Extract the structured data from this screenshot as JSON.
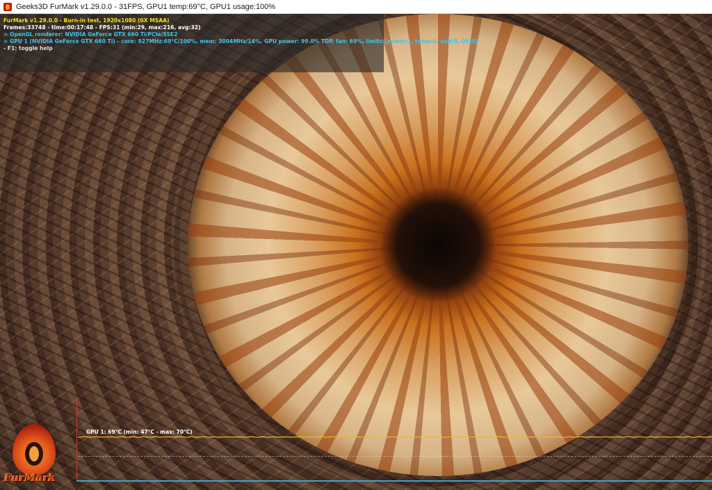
{
  "window": {
    "title": "Geeks3D FurMark v1.29.0.0 - 31FPS, GPU1 temp:69°C, GPU1 usage:100%",
    "icon": "furmark-app-icon"
  },
  "overlay": {
    "line1": "FurMark v1.29.0.0 - Burn-in test, 1920x1080 (0X MSAA)",
    "line2": "Frames:33748 - time:00:17:48 - FPS:31 (min:29, max:216, avg:32)",
    "line3": "> OpenGL renderer: NVIDIA GeForce GTX 660 Ti/PCIe/SSE2",
    "line4": "> GPU 1 (NVIDIA GeForce GTX 660 Ti) - core: 927MHz:69°C/100%, mem: 3004MHz/14%, GPU power: 99.0% TDP, fan: 69%, limits:[power:1, temp:0, volt:0, OV:0]",
    "line5": "- F1: toggle help",
    "colors": {
      "title": "#f6e11a",
      "stats": "#ffffff",
      "gpu_info": "#3fc6e8",
      "help": "#e0e0e0"
    }
  },
  "temp_graph": {
    "label": "GPU 1: 69°C (min: 47°C - max: 70°C)",
    "current_c": 69,
    "min_c": 47,
    "max_c": 70,
    "line_color": "#f0b432"
  },
  "logo": {
    "text": "FurMark",
    "icon": "furmark-flame-logo"
  }
}
